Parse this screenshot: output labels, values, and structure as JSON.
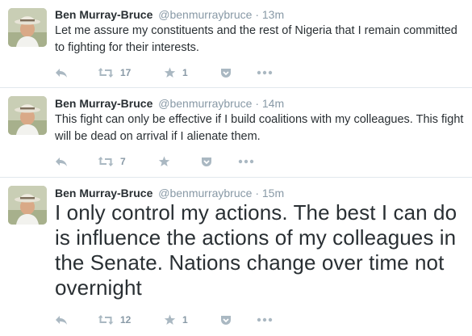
{
  "tweets": [
    {
      "name": "Ben Murray-Bruce",
      "handle": "@benmurraybruce",
      "separator": "·",
      "time": "13m",
      "text": "Let me assure my constituents and the rest of Nigeria that I remain committed to fighting for their interests.",
      "retweets": "17",
      "favorites": "1"
    },
    {
      "name": "Ben Murray-Bruce",
      "handle": "@benmurraybruce",
      "separator": "·",
      "time": "14m",
      "text": "This fight can only be effective if I build coalitions with my colleagues. This fight will be dead on arrival if I alienate them.",
      "retweets": "7",
      "favorites": ""
    },
    {
      "name": "Ben Murray-Bruce",
      "handle": "@benmurraybruce",
      "separator": "·",
      "time": "15m",
      "text": "I only control my actions. The best I can do is influence the actions of my colleagues in the Senate. Nations change over time not overnight",
      "retweets": "12",
      "favorites": "1"
    }
  ],
  "icons": {
    "reply": "reply-icon",
    "retweet": "retweet-icon",
    "favorite": "star-icon",
    "pocket": "save-to-pocket-icon",
    "more": "more-icon"
  },
  "colors": {
    "text": "#292f33",
    "muted": "#8899a6",
    "icon": "#aab8c2",
    "divider": "#e1e8ed"
  }
}
